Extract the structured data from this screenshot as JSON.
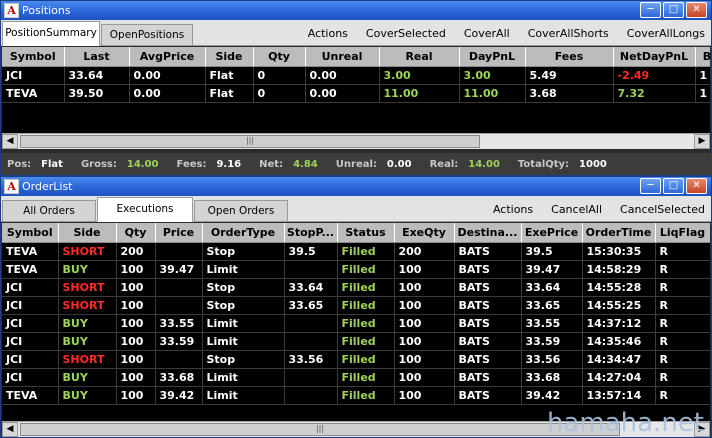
{
  "positions_window": {
    "title": "Positions",
    "tabs": [
      "PositionSummary",
      "OpenPositions"
    ],
    "actions": [
      "Actions",
      "CoverSelected",
      "CoverAll",
      "CoverAllShorts",
      "CoverAllLongs"
    ],
    "columns": [
      "Symbol",
      "Last",
      "AvgPrice",
      "Side",
      "Qty",
      "Unreal",
      "Real",
      "DayPnL",
      "Fees",
      "NetDayPnL",
      "B"
    ],
    "rows": [
      {
        "symbol": "JCI",
        "last": "33.64",
        "avgprice": "0.00",
        "side": "Flat",
        "qty": "0",
        "unreal": "0.00",
        "real": "3.00",
        "daypnl": "3.00",
        "fees": "5.49",
        "netdaypnl": "-2.49",
        "b": "1"
      },
      {
        "symbol": "TEVA",
        "last": "39.50",
        "avgprice": "0.00",
        "side": "Flat",
        "qty": "0",
        "unreal": "0.00",
        "real": "11.00",
        "daypnl": "11.00",
        "fees": "3.68",
        "netdaypnl": "7.32",
        "b": "1"
      }
    ],
    "summary": {
      "pos_label": "Pos:",
      "pos": "Flat",
      "gross_label": "Gross:",
      "gross": "14.00",
      "fees_label": "Fees:",
      "fees": "9.16",
      "net_label": "Net:",
      "net": "4.84",
      "unreal_label": "Unreal:",
      "unreal": "0.00",
      "real_label": "Real:",
      "real": "14.00",
      "totalqty_label": "TotalQty:",
      "totalqty": "1000"
    }
  },
  "orders_window": {
    "title": "OrderList",
    "tabs": [
      "All Orders",
      "Executions",
      "Open Orders"
    ],
    "actions": [
      "Actions",
      "CancelAll",
      "CancelSelected"
    ],
    "columns": [
      "Symbol",
      "Side",
      "Qty",
      "Price",
      "OrderType",
      "StopP...",
      "Status",
      "ExeQty",
      "Destina...",
      "ExePrice",
      "OrderTime",
      "LiqFlag"
    ],
    "rows": [
      {
        "symbol": "TEVA",
        "side": "SHORT",
        "qty": "200",
        "price": "",
        "ordertype": "Stop",
        "stop": "39.5",
        "status": "Filled",
        "exeqty": "200",
        "dest": "BATS",
        "exeprice": "39.5",
        "time": "15:30:35",
        "liq": "R"
      },
      {
        "symbol": "TEVA",
        "side": "BUY",
        "qty": "100",
        "price": "39.47",
        "ordertype": "Limit",
        "stop": "",
        "status": "Filled",
        "exeqty": "100",
        "dest": "BATS",
        "exeprice": "39.47",
        "time": "14:58:29",
        "liq": "R"
      },
      {
        "symbol": "JCI",
        "side": "SHORT",
        "qty": "100",
        "price": "",
        "ordertype": "Stop",
        "stop": "33.64",
        "status": "Filled",
        "exeqty": "100",
        "dest": "BATS",
        "exeprice": "33.64",
        "time": "14:55:28",
        "liq": "R"
      },
      {
        "symbol": "JCI",
        "side": "SHORT",
        "qty": "100",
        "price": "",
        "ordertype": "Stop",
        "stop": "33.65",
        "status": "Filled",
        "exeqty": "100",
        "dest": "BATS",
        "exeprice": "33.65",
        "time": "14:55:25",
        "liq": "R"
      },
      {
        "symbol": "JCI",
        "side": "BUY",
        "qty": "100",
        "price": "33.55",
        "ordertype": "Limit",
        "stop": "",
        "status": "Filled",
        "exeqty": "100",
        "dest": "BATS",
        "exeprice": "33.55",
        "time": "14:37:12",
        "liq": "R"
      },
      {
        "symbol": "JCI",
        "side": "BUY",
        "qty": "100",
        "price": "33.59",
        "ordertype": "Limit",
        "stop": "",
        "status": "Filled",
        "exeqty": "100",
        "dest": "BATS",
        "exeprice": "33.59",
        "time": "14:35:46",
        "liq": "R"
      },
      {
        "symbol": "JCI",
        "side": "SHORT",
        "qty": "100",
        "price": "",
        "ordertype": "Stop",
        "stop": "33.56",
        "status": "Filled",
        "exeqty": "100",
        "dest": "BATS",
        "exeprice": "33.56",
        "time": "14:34:47",
        "liq": "R"
      },
      {
        "symbol": "JCI",
        "side": "BUY",
        "qty": "100",
        "price": "33.68",
        "ordertype": "Limit",
        "stop": "",
        "status": "Filled",
        "exeqty": "100",
        "dest": "BATS",
        "exeprice": "33.68",
        "time": "14:27:04",
        "liq": "R"
      },
      {
        "symbol": "TEVA",
        "side": "BUY",
        "qty": "100",
        "price": "39.42",
        "ordertype": "Limit",
        "stop": "",
        "status": "Filled",
        "exeqty": "100",
        "dest": "BATS",
        "exeprice": "39.42",
        "time": "13:57:14",
        "liq": "R"
      }
    ]
  },
  "watermark": "hamaha.net",
  "colors": {
    "green": "#9ed25a",
    "red": "#ff2a2a",
    "titlebar": "#2a64d6"
  },
  "icons": {
    "app": "app-logo-icon",
    "minimize": "minimize-icon",
    "maximize": "maximize-icon",
    "close": "close-icon",
    "scroll_left": "arrow-left-icon",
    "scroll_right": "arrow-right-icon"
  }
}
